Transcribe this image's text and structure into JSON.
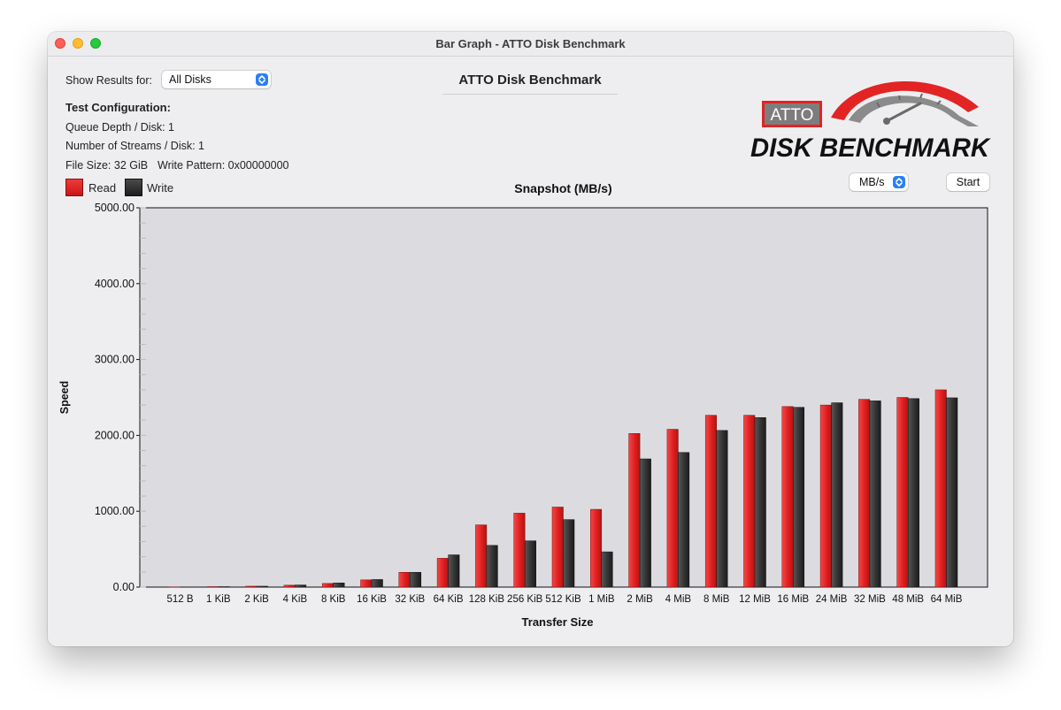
{
  "window": {
    "title": "Bar Graph - ATTO Disk Benchmark"
  },
  "controls": {
    "show_results_label": "Show Results for:",
    "disk_select_value": "All Disks",
    "units_select_value": "MB/s",
    "start_label": "Start"
  },
  "header": {
    "title": "ATTO Disk Benchmark"
  },
  "config": {
    "heading": "Test Configuration:",
    "queue_depth": "Queue Depth / Disk: 1",
    "streams": "Number of Streams / Disk: 1",
    "file_size": "File Size: 32 GiB",
    "write_pattern": "Write Pattern: 0x00000000"
  },
  "logo": {
    "badge": "ATTO",
    "text": "DISK BENCHMARK"
  },
  "legend": {
    "read": "Read",
    "write": "Write"
  },
  "colors": {
    "read": "#e22424",
    "write": "#333333",
    "plot_bg": "#dcdce0",
    "accent": "#2a7ff5"
  },
  "chart_data": {
    "type": "bar",
    "title": "Snapshot (MB/s)",
    "xlabel": "Transfer Size",
    "ylabel": "Speed",
    "ylim": [
      0,
      5000
    ],
    "yticks": [
      "0.00",
      "1000.00",
      "2000.00",
      "3000.00",
      "4000.00",
      "5000.00"
    ],
    "categories": [
      "512 B",
      "1 KiB",
      "2 KiB",
      "4 KiB",
      "8 KiB",
      "16 KiB",
      "32 KiB",
      "64 KiB",
      "128 KiB",
      "256 KiB",
      "512 KiB",
      "1 MiB",
      "2 MiB",
      "4 MiB",
      "8 MiB",
      "12 MiB",
      "16 MiB",
      "24 MiB",
      "32 MiB",
      "48 MiB",
      "64 MiB"
    ],
    "series": [
      {
        "name": "Read",
        "values": [
          3,
          6,
          12,
          25,
          48,
          95,
          195,
          380,
          820,
          975,
          1055,
          1025,
          2025,
          2080,
          2265,
          2265,
          2380,
          2400,
          2475,
          2500,
          2600
        ]
      },
      {
        "name": "Write",
        "values": [
          3,
          6,
          12,
          28,
          55,
          100,
          195,
          425,
          550,
          610,
          890,
          465,
          1690,
          1775,
          2065,
          2235,
          2370,
          2430,
          2455,
          2485,
          2495
        ]
      }
    ],
    "grid": false,
    "legend_position": "top-left"
  }
}
